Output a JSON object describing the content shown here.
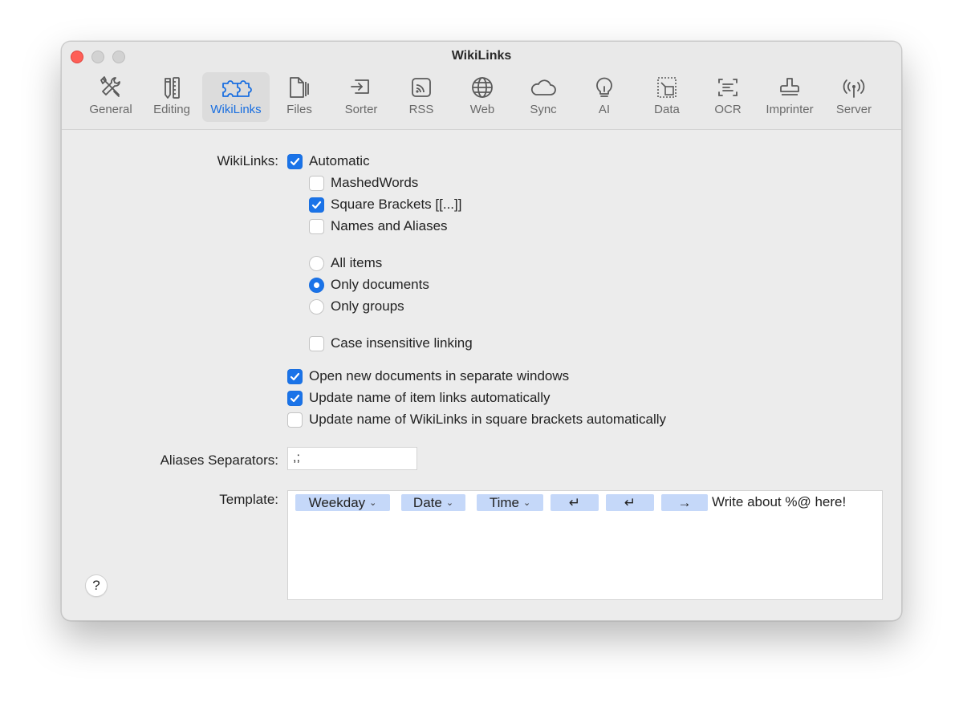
{
  "window": {
    "title": "WikiLinks"
  },
  "toolbar": {
    "items": [
      {
        "label": "General",
        "icon": "tools-icon"
      },
      {
        "label": "Editing",
        "icon": "pencil-ruler-icon"
      },
      {
        "label": "WikiLinks",
        "icon": "puzzle-icon",
        "active": true
      },
      {
        "label": "Files",
        "icon": "files-icon"
      },
      {
        "label": "Sorter",
        "icon": "sorter-icon"
      },
      {
        "label": "RSS",
        "icon": "rss-icon"
      },
      {
        "label": "Web",
        "icon": "globe-icon"
      },
      {
        "label": "Sync",
        "icon": "cloud-icon"
      },
      {
        "label": "AI",
        "icon": "lightbulb-icon"
      },
      {
        "label": "Data",
        "icon": "data-icon"
      },
      {
        "label": "OCR",
        "icon": "ocr-icon"
      },
      {
        "label": "Imprinter",
        "icon": "stamp-icon"
      },
      {
        "label": "Server",
        "icon": "antenna-icon"
      }
    ],
    "accent": "#1a6fe0"
  },
  "wikilinks": {
    "label": "WikiLinks:",
    "automatic": {
      "label": "Automatic",
      "checked": true
    },
    "mashed_words": {
      "label": "MashedWords",
      "checked": false
    },
    "square_brackets": {
      "label": "Square Brackets [[...]]",
      "checked": true
    },
    "names_aliases": {
      "label": "Names and Aliases",
      "checked": false
    },
    "scope": {
      "all_items": "All items",
      "only_documents": "Only documents",
      "only_groups": "Only groups",
      "selected": "Only documents"
    },
    "case_insensitive": {
      "label": "Case insensitive linking",
      "checked": false
    },
    "open_new_windows": {
      "label": "Open new documents in separate windows",
      "checked": true
    },
    "update_item_links": {
      "label": "Update name of item links automatically",
      "checked": true
    },
    "update_wikilinks": {
      "label": "Update name of WikiLinks in square brackets automatically",
      "checked": false
    }
  },
  "aliases": {
    "label": "Aliases Separators:",
    "value": ",;"
  },
  "template": {
    "label": "Template:",
    "tokens": [
      "Weekday",
      "Date",
      "Time",
      "↵",
      "↵",
      "→"
    ],
    "chevron": "⌄",
    "text": "Write about %@ here!"
  },
  "help": {
    "label": "?"
  }
}
